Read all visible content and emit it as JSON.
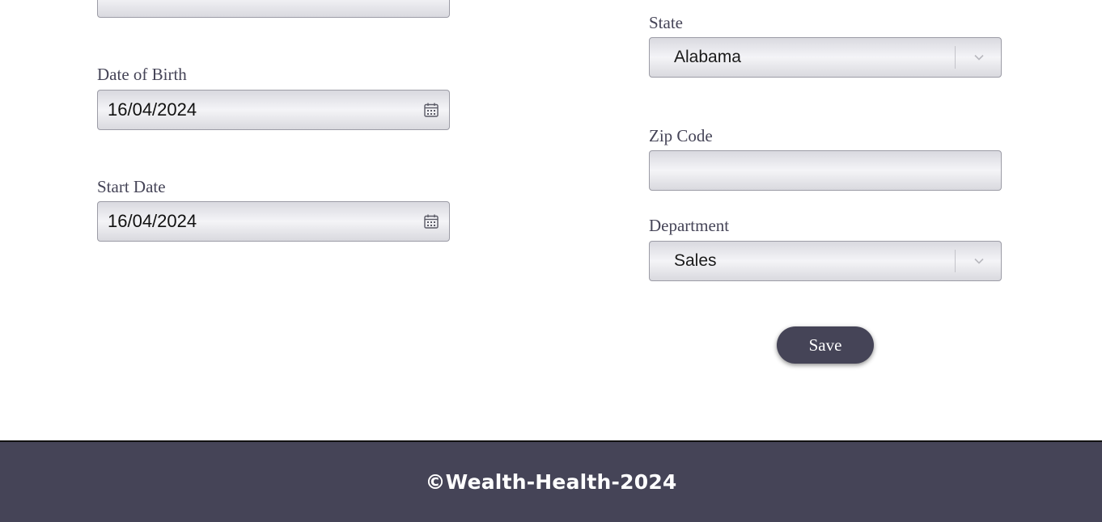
{
  "form": {
    "date_of_birth": {
      "label": "Date of Birth",
      "value": "16/04/2024"
    },
    "start_date": {
      "label": "Start Date",
      "value": "16/04/2024"
    },
    "state": {
      "label": "State",
      "value": "Alabama"
    },
    "zip_code": {
      "label": "Zip Code",
      "value": ""
    },
    "department": {
      "label": "Department",
      "value": "Sales"
    },
    "save_label": "Save"
  },
  "footer": {
    "text": "©Wealth-Health-2024"
  },
  "colors": {
    "primary": "#454457",
    "field_border": "#9c9ca6",
    "background": "#ffffff"
  }
}
